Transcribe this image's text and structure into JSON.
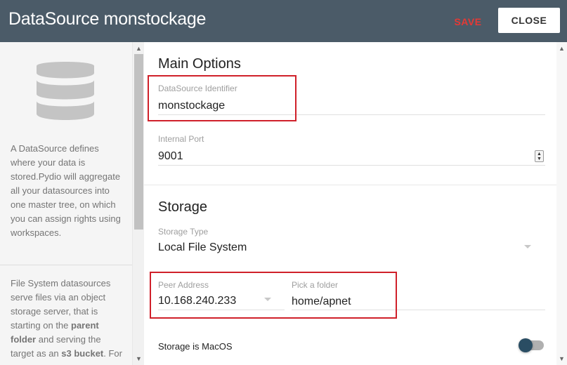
{
  "header": {
    "title": "DataSource monstockage",
    "save_label": "SAVE",
    "close_label": "CLOSE"
  },
  "sidebar": {
    "icon": "database-icon",
    "description_1": "A DataSource defines where your data is stored.Pydio will aggregate all your datasources into one master tree, on which you can assign rights using workspaces.",
    "description_2_parts": {
      "a": "File System datasources serve files via an object storage server, that is starting on the ",
      "b": "parent folder",
      "c": " and serving the target as an ",
      "d": "s3 bucket",
      "e": ". For"
    }
  },
  "main_options": {
    "title": "Main Options",
    "datasource_identifier": {
      "label": "DataSource Identifier",
      "value": "monstockage"
    },
    "internal_port": {
      "label": "Internal Port",
      "value": "9001"
    }
  },
  "storage": {
    "title": "Storage",
    "storage_type": {
      "label": "Storage Type",
      "value": "Local File System"
    },
    "peer_address": {
      "label": "Peer Address",
      "value": "10.168.240.233"
    },
    "pick_folder": {
      "label": "Pick a folder",
      "value": "home/apnet"
    },
    "macos_toggle": {
      "label": "Storage is MacOS",
      "on": true
    }
  },
  "colors": {
    "header_bg": "#4b5b68",
    "save": "#e53935",
    "highlight": "#d0202a",
    "toggle_knob": "#2a4d63"
  }
}
